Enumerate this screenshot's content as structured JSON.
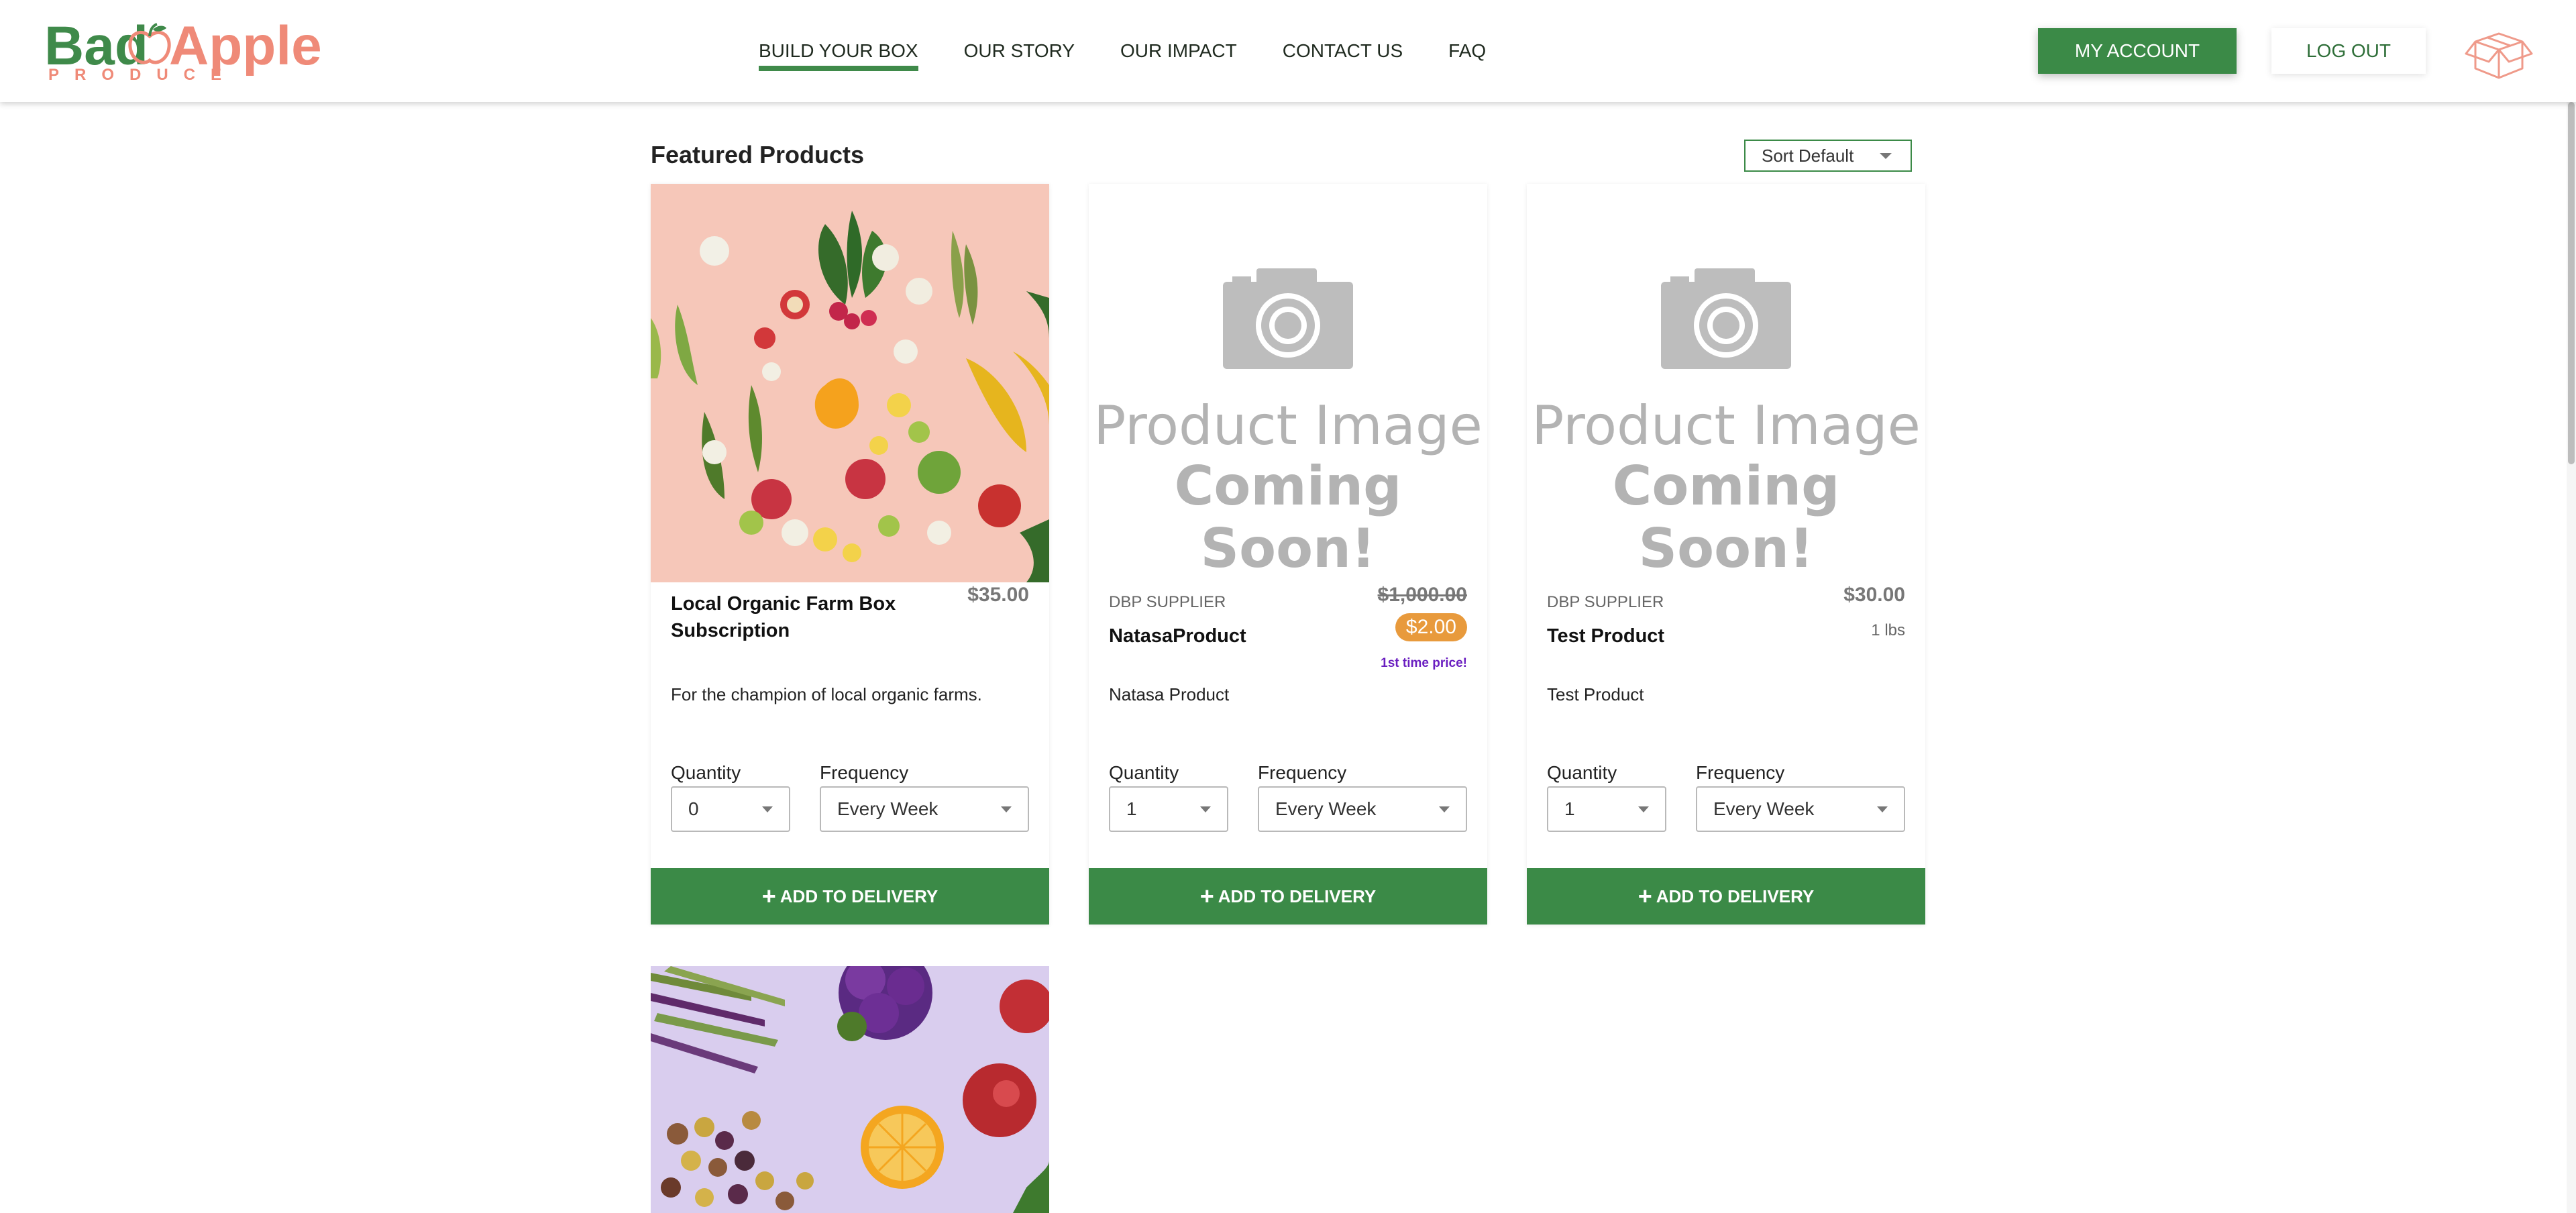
{
  "brand": {
    "word1": "Bad",
    "word2": "Apple",
    "sub": "PRODUCE",
    "color_green": "#3f8a4a",
    "color_peach": "#ef8a78"
  },
  "nav": {
    "items": [
      {
        "label": "BUILD YOUR BOX",
        "active": true
      },
      {
        "label": "OUR STORY"
      },
      {
        "label": "OUR IMPACT"
      },
      {
        "label": "CONTACT US"
      },
      {
        "label": "FAQ"
      }
    ]
  },
  "header": {
    "account_label": "MY ACCOUNT",
    "logout_label": "LOG OUT",
    "cart_icon": "box-icon"
  },
  "main": {
    "title": "Featured Products",
    "sort": {
      "selected": "Sort Default"
    }
  },
  "products": [
    {
      "name": "Local Organic Farm Box Subscription",
      "price": "$35.00",
      "description": "For the champion of local organic farms.",
      "quantity_label": "Quantity",
      "quantity": "0",
      "frequency_label": "Frequency",
      "frequency": "Every Week",
      "add_label": "ADD TO DELIVERY"
    },
    {
      "supplier": "DBP SUPPLIER",
      "name": "NatasaProduct",
      "original_price": "$1,000.00",
      "promo_price": "$2.00",
      "promo_note": "1st time price!",
      "description": "Natasa Product",
      "quantity_label": "Quantity",
      "quantity": "1",
      "frequency_label": "Frequency",
      "frequency": "Every Week",
      "add_label": "ADD TO DELIVERY",
      "image_placeholder": {
        "line1": "Product Image",
        "line2": "Coming Soon!"
      }
    },
    {
      "supplier": "DBP SUPPLIER",
      "name": "Test Product",
      "price": "$30.00",
      "unit": "1 lbs",
      "description": "Test Product",
      "quantity_label": "Quantity",
      "quantity": "1",
      "frequency_label": "Frequency",
      "frequency": "Every Week",
      "add_label": "ADD TO DELIVERY",
      "image_placeholder": {
        "line1": "Product Image",
        "line2": "Coming Soon!"
      }
    }
  ],
  "colors": {
    "primary_green": "#3b8a47",
    "promo_orange": "#e89a3c",
    "promo_purple": "#6a1ec0"
  }
}
